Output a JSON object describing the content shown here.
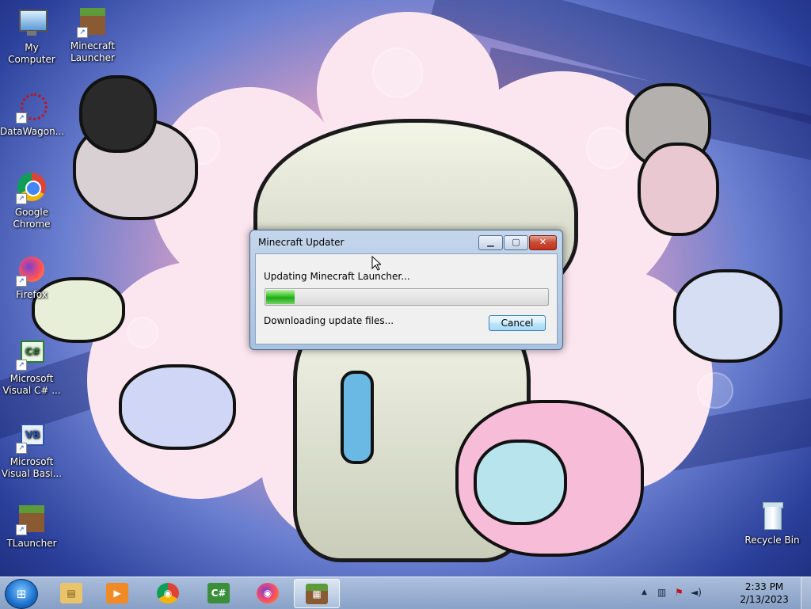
{
  "desktop_icons": [
    {
      "label": "My Computer",
      "icon": "computer-icon"
    },
    {
      "label": "Minecraft Launcher",
      "icon": "minecraft-grass-block-icon"
    },
    {
      "label": "DataWagon...",
      "icon": "datawagon-icon"
    },
    {
      "label": "Google Chrome",
      "icon": "chrome-icon"
    },
    {
      "label": "Firefox",
      "icon": "firefox-icon"
    },
    {
      "label": "Microsoft Visual C# ...",
      "icon": "visual-csharp-icon"
    },
    {
      "label": "Microsoft Visual Basi...",
      "icon": "visual-basic-icon"
    },
    {
      "label": "TLauncher",
      "icon": "minecraft-grass-block-icon"
    },
    {
      "label": "Recycle Bin",
      "icon": "recycle-bin-icon"
    }
  ],
  "dialog": {
    "title": "Minecraft Updater",
    "message": "Updating Minecraft Launcher...",
    "progress": 0.1,
    "status": "Downloading update files...",
    "cancel_label": "Cancel",
    "minimize_glyph": "▁",
    "maximize_glyph": "▢",
    "close_glyph": "✕"
  },
  "taskbar": {
    "start_glyph": "⊞",
    "pinned": [
      {
        "icon": "windows-explorer-icon",
        "glyph": "▤",
        "color": "#e9c46a",
        "active": false
      },
      {
        "icon": "media-player-icon",
        "glyph": "▶",
        "color": "#f08a24",
        "active": false
      },
      {
        "icon": "chrome-icon",
        "glyph": "◉",
        "color": "#dd4b39",
        "active": false
      },
      {
        "icon": "visual-csharp-icon",
        "glyph": "C#",
        "color": "#3b8f3b",
        "active": false
      },
      {
        "icon": "firefox-icon",
        "glyph": "◉",
        "color": "#ff7a1a",
        "active": false
      },
      {
        "icon": "minecraft-grass-block-icon",
        "glyph": "▦",
        "color": "#5d8f3a",
        "active": true
      }
    ],
    "tray": {
      "show_hidden_glyph": "▲",
      "network_glyph": "▥",
      "action_center_glyph": "⚑",
      "volume_glyph": "◄)",
      "time": "2:33 PM",
      "date": "2/13/2023"
    }
  }
}
